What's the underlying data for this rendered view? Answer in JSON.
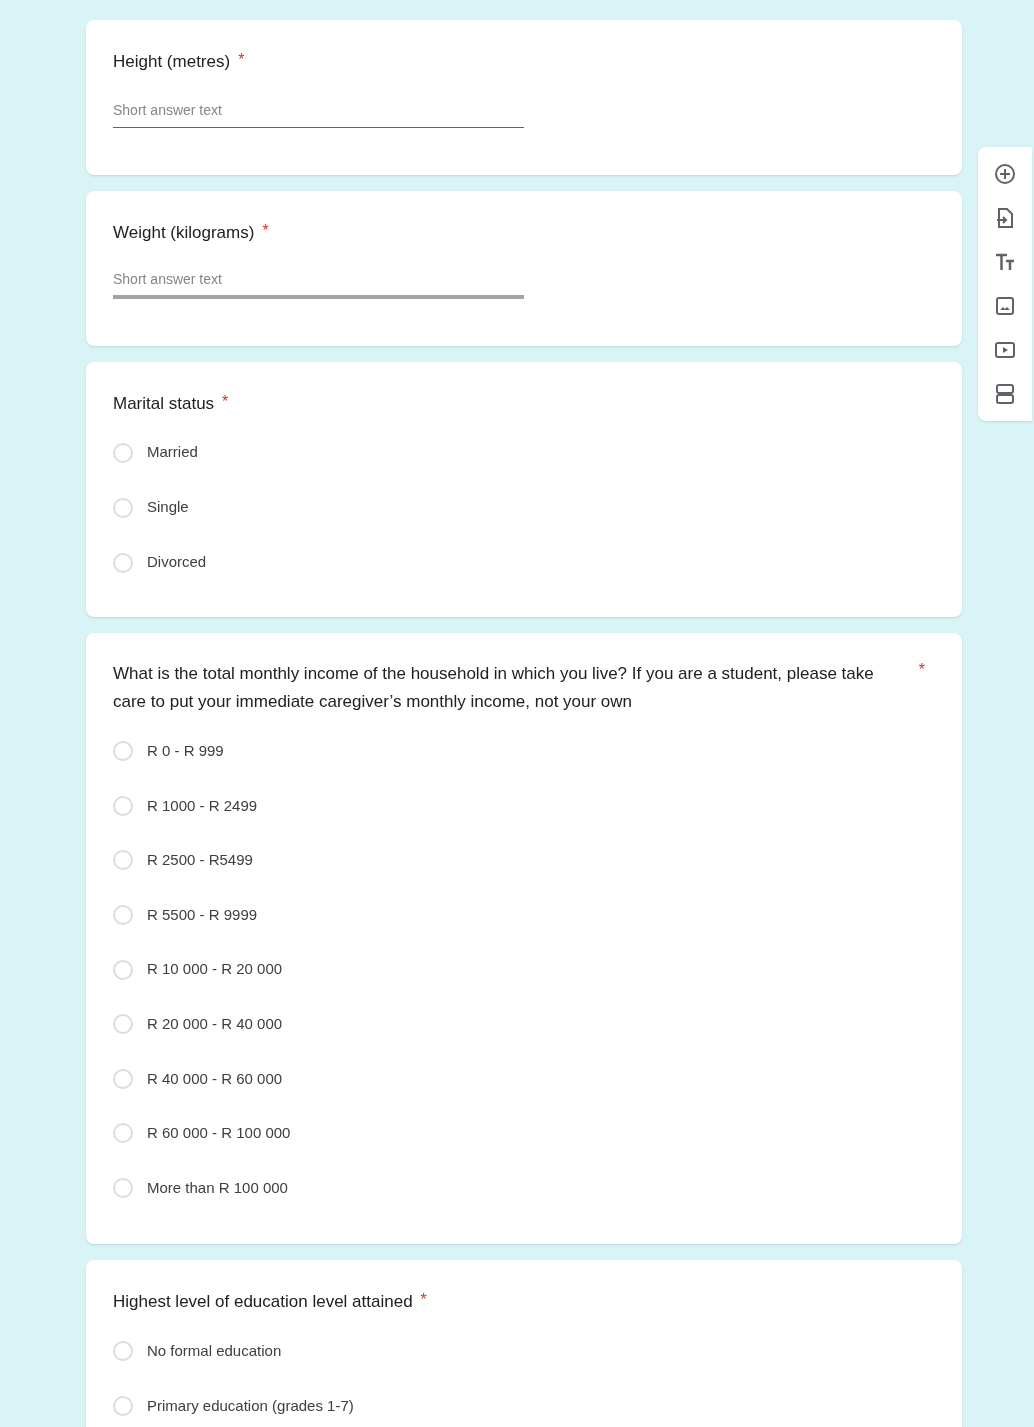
{
  "questions": [
    {
      "kind": "short",
      "title": "Height (metres)",
      "asterisk": "*",
      "placeholder": "Short answer text",
      "focused": false
    },
    {
      "kind": "short",
      "title": "Weight (kilograms)",
      "asterisk": "*",
      "placeholder": "Short answer text",
      "focused": true
    },
    {
      "kind": "choice",
      "title": "Marital status",
      "asterisk": "*",
      "options": [
        {
          "label": "Married",
          "selected": false
        },
        {
          "label": "Single",
          "selected": false
        },
        {
          "label": "Divorced",
          "selected": false
        }
      ]
    },
    {
      "kind": "choice",
      "title": "What is the total monthly income of the household in which you live? If you are a student, please take care to put your immediate caregiver’s monthly income, not your own",
      "asterisk": "*",
      "options": [
        {
          "label": "R 0 - R 999",
          "selected": false
        },
        {
          "label": "R 1000 - R 2499",
          "selected": false
        },
        {
          "label": "R 2500 - R5499",
          "selected": false
        },
        {
          "label": "R 5500 - R 9999",
          "selected": false
        },
        {
          "label": "R 10 000 - R 20 000",
          "selected": false
        },
        {
          "label": "R 20 000 - R 40 000",
          "selected": false
        },
        {
          "label": "R 40 000 - R 60 000",
          "selected": false
        },
        {
          "label": "R 60 000 - R 100 000",
          "selected": false
        },
        {
          "label": "More than R 100 000",
          "selected": false
        }
      ]
    },
    {
      "kind": "choice",
      "title": "Highest level of education level attained",
      "asterisk": "*",
      "options": [
        {
          "label": "No formal education",
          "selected": false
        },
        {
          "label": "Primary education (grades 1-7)",
          "selected": false
        }
      ]
    }
  ],
  "toolbar": {
    "tools": [
      {
        "kind": "add"
      },
      {
        "kind": "import"
      },
      {
        "kind": "title"
      },
      {
        "kind": "image"
      },
      {
        "kind": "video"
      },
      {
        "kind": "section"
      }
    ]
  }
}
